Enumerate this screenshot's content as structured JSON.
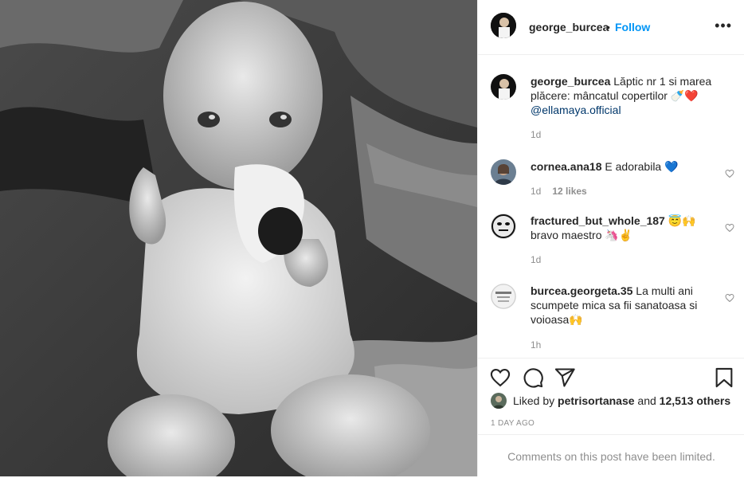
{
  "post": {
    "author": "george_burcea",
    "separator": "•",
    "follow_label": "Follow",
    "more_label": "•••",
    "photo_alt": "Black and white photo of a baby chewing a book",
    "caption_user": "george_burcea",
    "caption_text": "Lăptic nr 1 si marea plăcere: mâncatul copertilor 🍼❤️",
    "caption_mention": "@ellamaya.official",
    "caption_age": "1d"
  },
  "comments": [
    {
      "user": "cornea.ana18",
      "text": "E adorabila 💙",
      "age": "1d",
      "likes": "12 likes"
    },
    {
      "user": "fractured_but_whole_187",
      "text": "😇🙌",
      "text2": "bravo maestro 🦄✌️",
      "age": "1d",
      "likes": ""
    },
    {
      "user": "burcea.georgeta.35",
      "text": "La multi ani scumpete mica sa fii sanatoasa si voioasa🙌",
      "age": "1h",
      "likes": ""
    }
  ],
  "likes": {
    "prefix": "Liked by ",
    "user": "petrisortanase",
    "middle": " and ",
    "count": "12,513 others"
  },
  "date": "1 DAY AGO",
  "comments_limited": "Comments on this post have been limited.",
  "colors": {
    "accent": "#0095f6",
    "muted": "#8e8e8e",
    "heart": "#ed4956",
    "blue_heart": "#1d7bd8"
  }
}
